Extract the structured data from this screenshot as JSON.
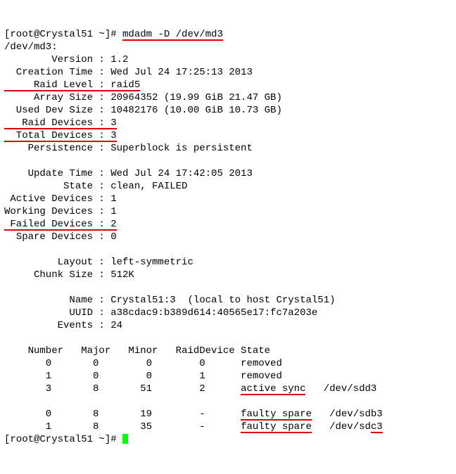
{
  "p0a": "[root@Crystal51 ~]# ",
  "p0b": "mdadm -D /dev/md3",
  "l1": "/dev/md3:",
  "l2": "        Version : 1.2",
  "l3": "  Creation Time : Wed Jul 24 17:25:13 2013",
  "l4a": "     Raid Level : raid5",
  "l5": "     Array Size : 20964352 (19.99 GiB 21.47 GB)",
  "l6": "  Used Dev Size : 10482176 (10.00 GiB 10.73 GB)",
  "l7a": "   Raid Devices : 3",
  "l8a": "  Total Devices : 3",
  "l9": "    Persistence : Superblock is persistent",
  "l10": "",
  "l11": "    Update Time : Wed Jul 24 17:42:05 2013",
  "l12": "          State : clean, FAILED",
  "l13": " Active Devices : 1",
  "l14": "Working Devices : 1",
  "l15a": " Failed Devices : 2",
  "l16": "  Spare Devices : 0",
  "l17": "",
  "l18": "         Layout : left-symmetric",
  "l19": "     Chunk Size : 512K",
  "l20": "",
  "l21": "           Name : Crystal51:3  (local to host Crystal51)",
  "l22": "           UUID : a38cdac9:b389d614:40565e17:fc7a203e",
  "l23": "         Events : 24",
  "l24": "",
  "l25": "    Number   Major   Minor   RaidDevice State",
  "l26": "       0       0        0        0      removed",
  "l27": "       1       0        0        1      removed",
  "l28a": "       3       8       51        2      ",
  "l28b": "active sync",
  "l28c": "   /dev/sdd3",
  "l29": "",
  "l30a": "       0       8       19        -      ",
  "l30b": "faulty spare",
  "l30c": "   /dev/sdb3",
  "l31a": "       1       8       35        -      ",
  "l31b": "faulty spare",
  "l31c": "   /dev/sd",
  "l31d": "c3",
  "pEnd": "[root@Crystal51 ~]# "
}
